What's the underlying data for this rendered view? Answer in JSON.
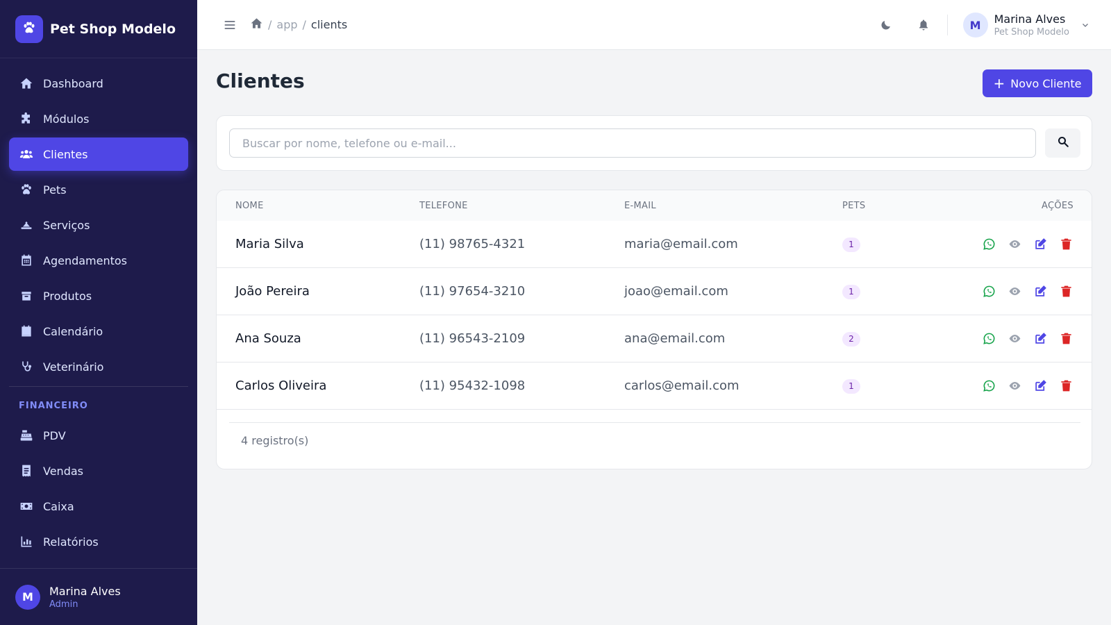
{
  "brand": {
    "name": "Pet Shop Modelo",
    "icon": "paw-icon"
  },
  "sidebar": {
    "items": [
      {
        "label": "Dashboard",
        "icon": "home-icon",
        "active": false
      },
      {
        "label": "Módulos",
        "icon": "puzzle-icon",
        "active": false
      },
      {
        "label": "Clientes",
        "icon": "users-icon",
        "active": true
      },
      {
        "label": "Pets",
        "icon": "paw-icon",
        "active": false
      },
      {
        "label": "Serviços",
        "icon": "grooming-icon",
        "active": false
      },
      {
        "label": "Agendamentos",
        "icon": "calendar-grid-icon",
        "active": false
      },
      {
        "label": "Produtos",
        "icon": "box-icon",
        "active": false
      },
      {
        "label": "Calendário",
        "icon": "calendar-icon",
        "active": false
      },
      {
        "label": "Veterinário",
        "icon": "stethoscope-icon",
        "active": false
      }
    ],
    "section_financeiro": "FINANCEIRO",
    "finance_items": [
      {
        "label": "PDV",
        "icon": "cash-register-icon"
      },
      {
        "label": "Vendas",
        "icon": "receipt-icon"
      },
      {
        "label": "Caixa",
        "icon": "money-icon"
      },
      {
        "label": "Relatórios",
        "icon": "bar-chart-icon"
      }
    ],
    "footer": {
      "initial": "M",
      "name": "Marina Alves",
      "role": "Admin"
    }
  },
  "header": {
    "breadcrumb": {
      "separator": "/",
      "app": "app",
      "current": "clients"
    },
    "user": {
      "initial": "M",
      "name": "Marina Alves",
      "org": "Pet Shop Modelo"
    }
  },
  "main": {
    "title": "Clientes",
    "new_button": {
      "plus": "+",
      "label": "Novo Cliente"
    },
    "search": {
      "placeholder": "Buscar por nome, telefone ou e-mail...",
      "value": ""
    },
    "table": {
      "headers": {
        "name": "NOME",
        "phone": "TELEFONE",
        "email": "E-MAIL",
        "pets": "PETS",
        "actions": "AÇÕES"
      },
      "rows": [
        {
          "name": "Maria Silva",
          "phone": "(11) 98765-4321",
          "email": "maria@email.com",
          "pets": "1"
        },
        {
          "name": "João Pereira",
          "phone": "(11) 97654-3210",
          "email": "joao@email.com",
          "pets": "1"
        },
        {
          "name": "Ana Souza",
          "phone": "(11) 96543-2109",
          "email": "ana@email.com",
          "pets": "2"
        },
        {
          "name": "Carlos Oliveira",
          "phone": "(11) 95432-1098",
          "email": "carlos@email.com",
          "pets": "1"
        }
      ],
      "footer": "4 registro(s)"
    }
  },
  "colors": {
    "sidebar_bg": "#1e1b4b",
    "accent": "#4f46e5",
    "whatsapp": "#16a34a",
    "view": "#9ca3af",
    "edit": "#4f46e5",
    "delete": "#dc2626"
  }
}
